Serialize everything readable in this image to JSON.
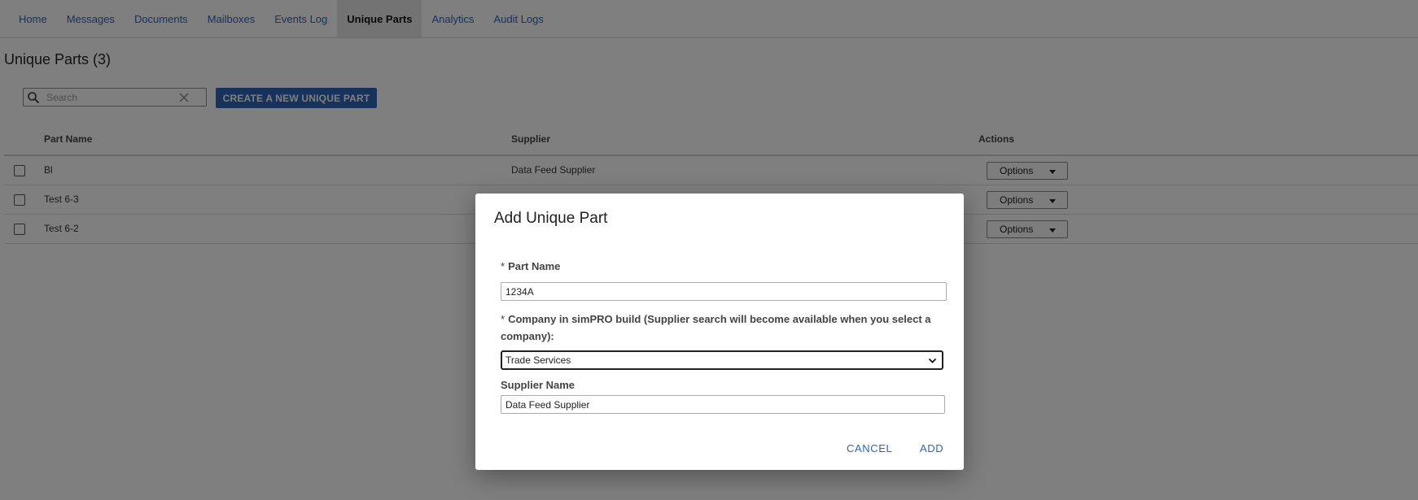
{
  "nav": {
    "items": [
      {
        "label": "Home"
      },
      {
        "label": "Messages"
      },
      {
        "label": "Documents"
      },
      {
        "label": "Mailboxes"
      },
      {
        "label": "Events Log"
      },
      {
        "label": "Unique Parts"
      },
      {
        "label": "Analytics"
      },
      {
        "label": "Audit Logs"
      }
    ],
    "active": "Unique Parts"
  },
  "page": {
    "title": "Unique Parts (3)"
  },
  "search": {
    "placeholder": "Search",
    "value": ""
  },
  "toolbar": {
    "create_label": "CREATE A NEW UNIQUE PART"
  },
  "table": {
    "headers": {
      "part_name": "Part Name",
      "supplier": "Supplier",
      "actions": "Actions"
    },
    "rows": [
      {
        "part_name": "Bl",
        "supplier": "Data Feed Supplier",
        "action_label": "Options"
      },
      {
        "part_name": "Test 6-3",
        "supplier": "",
        "action_label": "Options"
      },
      {
        "part_name": "Test 6-2",
        "supplier": "",
        "action_label": "Options"
      }
    ]
  },
  "dialog": {
    "title": "Add Unique Part",
    "required_marker": "*",
    "part_name_label": "Part Name",
    "part_name_value": "1234A",
    "company_label": "Company in simPRO build (Supplier search will become available when you select a company):",
    "company_value": "Trade Services",
    "supplier_label": "Supplier Name",
    "supplier_value": "Data Feed Supplier",
    "cancel_label": "CANCEL",
    "add_label": "ADD"
  },
  "colors": {
    "accent": "#2f64b6",
    "overlay": "rgba(0,0,0,0.5)"
  },
  "icons": {
    "search": "search-icon",
    "clear": "close-icon",
    "caret": "caret-down-icon",
    "select": "chevron-down-icon"
  }
}
